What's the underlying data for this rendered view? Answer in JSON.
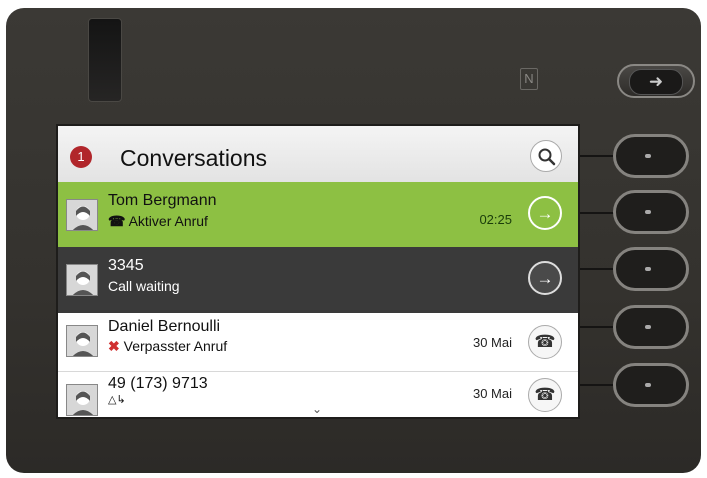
{
  "header": {
    "badge_count": "1",
    "title": "Conversations",
    "search_icon": "search-icon"
  },
  "top": {
    "nfc_label": "N",
    "logout_icon": "logout-arrow-icon"
  },
  "rows": [
    {
      "name": "Tom Bergmann",
      "status": "Aktiver Anruf",
      "status_icon": "handset-icon",
      "time": "02:25",
      "action_icon": "arrow-right-icon",
      "state": "active"
    },
    {
      "name": "3345",
      "status": "Call waiting",
      "status_icon": "",
      "time": "",
      "action_icon": "arrow-right-icon",
      "state": "waiting"
    },
    {
      "name": "Daniel Bernoulli",
      "status": "Verpasster Anruf",
      "status_icon": "missed-call-icon",
      "time": "30 Mai",
      "action_icon": "handset-icon",
      "state": "missed"
    },
    {
      "name": "49 (173) 9713",
      "status": "",
      "status_icon": "forwarded-call-icon",
      "time": "30 Mai",
      "action_icon": "handset-icon",
      "state": "normal"
    }
  ],
  "colors": {
    "active_row": "#8dc043",
    "waiting_row": "#3a3a3a",
    "badge": "#b1262b"
  },
  "scroll_icon": "chevron-down-icon"
}
